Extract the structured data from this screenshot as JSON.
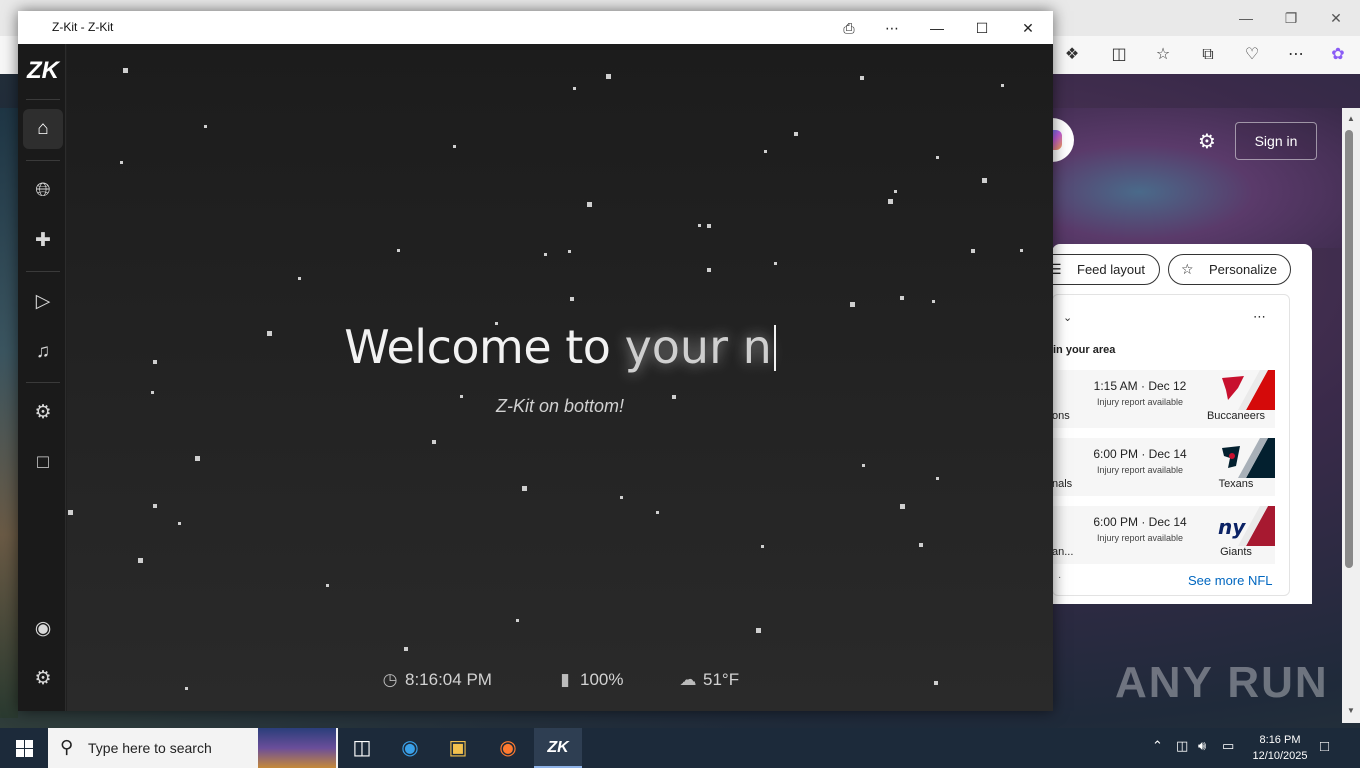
{
  "zkit": {
    "window_title": "Z-Kit - Z-Kit",
    "logo_text": "ZK",
    "welcome_prefix": "Welcome to ",
    "welcome_typed": "your n",
    "subtitle": "Z-Kit on bottom!",
    "status": {
      "time": "8:16:04 PM",
      "battery": "100%",
      "weather": "51°F"
    }
  },
  "browser": {
    "sign_in": "Sign in",
    "feed_layout": "Feed layout",
    "personalize": "Personalize",
    "nfl": {
      "subtitle": "in your area",
      "games": [
        {
          "left": "ons",
          "time": "1:15 AM · Dec 12",
          "note": "Injury report available",
          "team": "Buccaneers",
          "color": "#d50a0a"
        },
        {
          "left": "nals",
          "time": "6:00 PM · Dec 14",
          "note": "Injury report available",
          "team": "Texans",
          "color": "#03202f"
        },
        {
          "left": "an...",
          "time": "6:00 PM · Dec 14",
          "note": "Injury report available",
          "team": "Giants",
          "color": "#a71930"
        }
      ],
      "see_more": "See more NFL"
    },
    "watermark": "ANY RUN"
  },
  "taskbar": {
    "search_placeholder": "Type here to search",
    "clock_time": "8:16 PM",
    "clock_date": "12/10/2025"
  },
  "colors": {
    "zkit_bg": "#202020",
    "accent_link": "#0067c0",
    "taskbar": "#1c2a3a"
  }
}
